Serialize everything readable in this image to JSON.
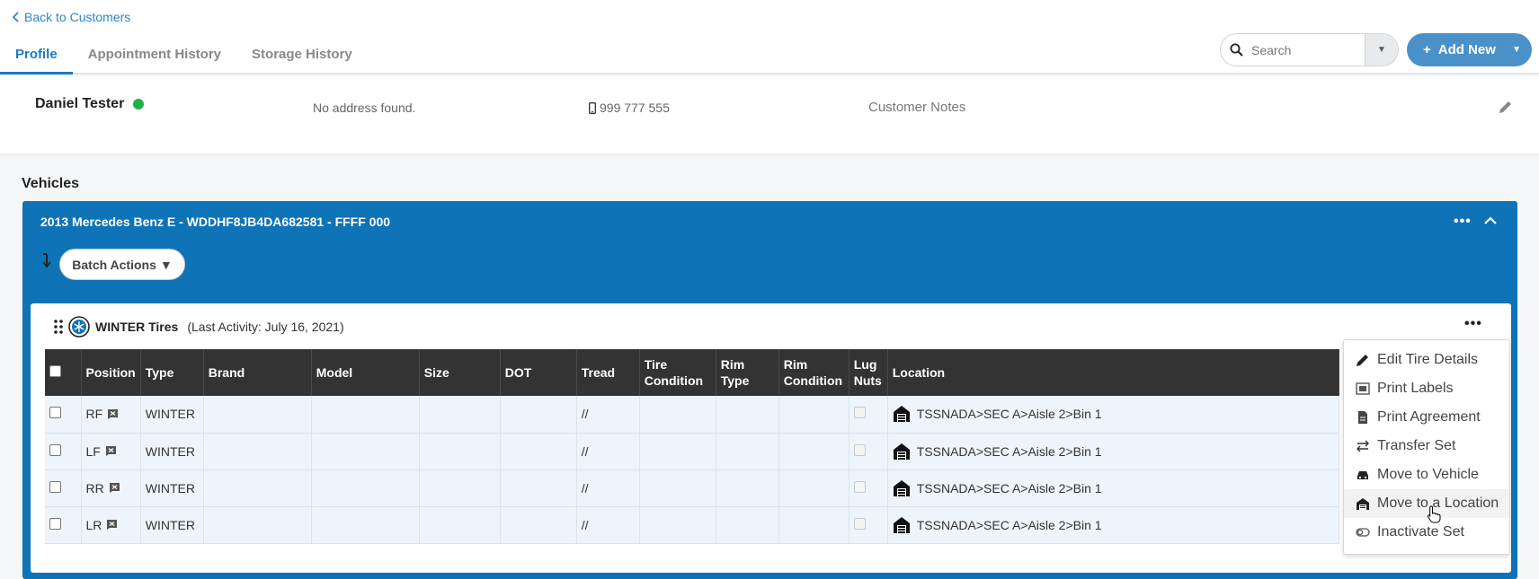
{
  "nav": {
    "back_label": "Back to Customers",
    "tabs": [
      {
        "label": "Profile",
        "active": true
      },
      {
        "label": "Appointment History",
        "active": false
      },
      {
        "label": "Storage History",
        "active": false
      }
    ],
    "search_placeholder": "Search",
    "add_new_label": "Add New"
  },
  "customer": {
    "name": "Daniel Tester",
    "status_color": "#21b14a",
    "address": "No address found.",
    "phone": "999 777 555",
    "notes": "Customer Notes"
  },
  "vehicles_title": "Vehicles",
  "vehicle": {
    "title": "2013 Mercedes Benz E - WDDHF8JB4DA682581 - FFFF 000",
    "batch_actions_label": "Batch Actions",
    "set": {
      "name": "WINTER Tires",
      "last_activity": "(Last Activity: July 16, 2021)",
      "columns": [
        "Position",
        "Type",
        "Brand",
        "Model",
        "Size",
        "DOT",
        "Tread",
        "Tire Condition",
        "Rim Type",
        "Rim Condition",
        "Lug Nuts",
        "Location"
      ],
      "rows": [
        {
          "position": "RF",
          "type": "WINTER",
          "brand": "",
          "model": "",
          "size": "",
          "dot": "",
          "tread": "//",
          "tire_condition": "",
          "rim_type": "",
          "rim_condition": "",
          "location": "TSSNADA>SEC A>Aisle 2>Bin 1"
        },
        {
          "position": "LF",
          "type": "WINTER",
          "brand": "",
          "model": "",
          "size": "",
          "dot": "",
          "tread": "//",
          "tire_condition": "",
          "rim_type": "",
          "rim_condition": "",
          "location": "TSSNADA>SEC A>Aisle 2>Bin 1"
        },
        {
          "position": "RR",
          "type": "WINTER",
          "brand": "",
          "model": "",
          "size": "",
          "dot": "",
          "tread": "//",
          "tire_condition": "",
          "rim_type": "",
          "rim_condition": "",
          "location": "TSSNADA>SEC A>Aisle 2>Bin 1"
        },
        {
          "position": "LR",
          "type": "WINTER",
          "brand": "",
          "model": "",
          "size": "",
          "dot": "",
          "tread": "//",
          "tire_condition": "",
          "rim_type": "",
          "rim_condition": "",
          "location": "TSSNADA>SEC A>Aisle 2>Bin 1"
        }
      ]
    }
  },
  "menu": {
    "items": [
      {
        "label": "Edit Tire Details",
        "icon": "pencil-icon"
      },
      {
        "label": "Print Labels",
        "icon": "label-icon"
      },
      {
        "label": "Print Agreement",
        "icon": "document-icon"
      },
      {
        "label": "Transfer Set",
        "icon": "transfer-icon"
      },
      {
        "label": "Move to Vehicle",
        "icon": "car-icon"
      },
      {
        "label": "Move to a Location",
        "icon": "warehouse-icon",
        "hovered": true
      },
      {
        "label": "Inactivate Set",
        "icon": "toggle-icon"
      }
    ]
  },
  "colors": {
    "primary": "#1e78bd",
    "vehicle_bg": "#0f73b8",
    "header_dark": "#333333"
  }
}
